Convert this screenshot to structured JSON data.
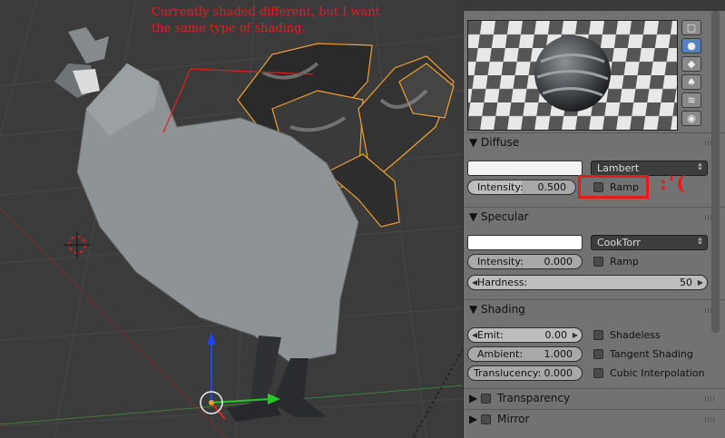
{
  "annotation": {
    "line1": "Currently shaded different, but I want",
    "line2": "the same type of shading.",
    "sad_face": ":'("
  },
  "preview_tools": [
    {
      "name": "plane-preview-icon",
      "glyph": "▢",
      "active": false
    },
    {
      "name": "sphere-preview-icon",
      "glyph": "●",
      "active": true
    },
    {
      "name": "cube-preview-icon",
      "glyph": "◆",
      "active": false
    },
    {
      "name": "monkey-preview-icon",
      "glyph": "♠",
      "active": false
    },
    {
      "name": "hair-preview-icon",
      "glyph": "≋",
      "active": false
    },
    {
      "name": "sphere-sky-preview-icon",
      "glyph": "◉",
      "active": false
    }
  ],
  "diffuse": {
    "header": "Diffuse",
    "shader": "Lambert",
    "intensity_label": "Intensity:",
    "intensity_value": "0.500",
    "ramp_label": "Ramp",
    "color": "#f2f2f2"
  },
  "specular": {
    "header": "Specular",
    "shader": "CookTorr",
    "intensity_label": "Intensity:",
    "intensity_value": "0.000",
    "ramp_label": "Ramp",
    "hardness_label": "Hardness:",
    "hardness_value": "50",
    "color": "#ffffff"
  },
  "shading": {
    "header": "Shading",
    "emit_label": "Emit:",
    "emit_value": "0.00",
    "ambient_label": "Ambient:",
    "ambient_value": "1.000",
    "translucency_label": "Translucency:",
    "translucency_value": "0.000",
    "shadeless_label": "Shadeless",
    "tangent_label": "Tangent Shading",
    "cubic_label": "Cubic Interpolation"
  },
  "transparency": {
    "header": "Transparency"
  },
  "mirror": {
    "header": "Mirror"
  },
  "colors": {
    "highlight": "#e61b1b",
    "selection_outline": "#f0a030",
    "active_tool": "#5680c2"
  }
}
